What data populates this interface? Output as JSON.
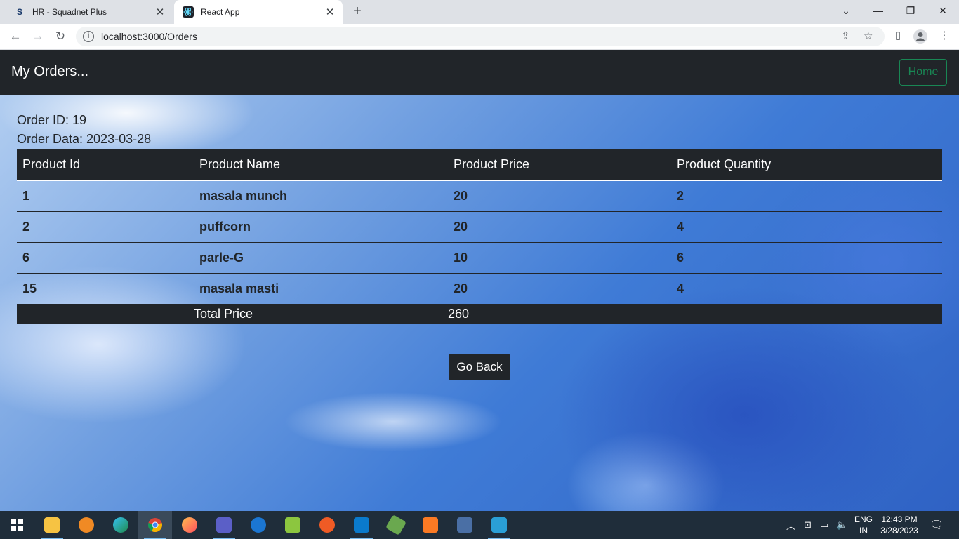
{
  "browser": {
    "tabs": [
      {
        "title": "HR - Squadnet Plus",
        "favicon": "S",
        "active": false
      },
      {
        "title": "React App",
        "favicon": "react-icon",
        "active": true
      }
    ],
    "url": "localhost:3000/Orders"
  },
  "navbar": {
    "brand": "My Orders...",
    "home_label": "Home"
  },
  "order": {
    "id_text": "Order ID: 19",
    "date_text": "Order Data: 2023-03-28"
  },
  "table": {
    "headers": [
      "Product Id",
      "Product Name",
      "Product Price",
      "Product Quantity"
    ],
    "rows": [
      {
        "id": "1",
        "name": "masala munch",
        "price": "20",
        "qty": "2"
      },
      {
        "id": "2",
        "name": "puffcorn",
        "price": "20",
        "qty": "4"
      },
      {
        "id": "6",
        "name": "parle-G",
        "price": "10",
        "qty": "6"
      },
      {
        "id": "15",
        "name": "masala masti",
        "price": "20",
        "qty": "4"
      }
    ],
    "total_label": "Total Price",
    "total_value": "260"
  },
  "go_back_label": "Go Back",
  "taskbar": {
    "language": "ENG",
    "region": "IN",
    "time": "12:43 PM",
    "date": "3/28/2023"
  },
  "colors": {
    "navbar_bg": "#212529",
    "home_outline": "#198754"
  }
}
